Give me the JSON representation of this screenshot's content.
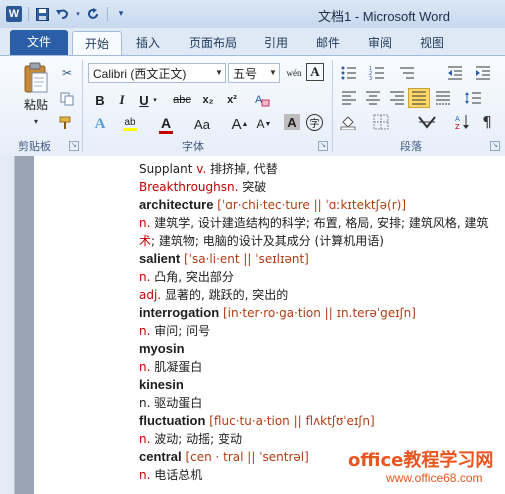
{
  "window": {
    "title": "文档1 - Microsoft Word"
  },
  "qat": {
    "app_icon": "W"
  },
  "tabs": [
    {
      "label": "文件"
    },
    {
      "label": "开始"
    },
    {
      "label": "插入"
    },
    {
      "label": "页面布局"
    },
    {
      "label": "引用"
    },
    {
      "label": "邮件"
    },
    {
      "label": "审阅"
    },
    {
      "label": "视图"
    }
  ],
  "ribbon": {
    "paste_label": "粘贴",
    "font_name": "Calibri (西文正文)",
    "font_size": "五号",
    "groups": {
      "clipboard": "剪贴板",
      "font": "字体",
      "paragraph": "段落"
    },
    "buttons": {
      "bold": "B",
      "italic": "I",
      "underline": "U",
      "strike": "abc",
      "subscript": "x₂",
      "superscript": "x²",
      "grow": "A",
      "shrink": "A",
      "change_case": "Aa",
      "font_color": "A",
      "highlight": "ab",
      "text_effect": "A",
      "wen": "wén"
    }
  },
  "document": {
    "lines": [
      {
        "parts": [
          {
            "t": "Supplant ",
            "c": "plain"
          },
          {
            "t": "v.",
            "c": "pos"
          },
          {
            "t": "  排挤掉, 代替",
            "c": "plain"
          }
        ]
      },
      {
        "parts": [
          {
            "t": "Breakthroughs",
            "c": "red"
          },
          {
            "t": "n.",
            "c": "pos"
          },
          {
            "t": "  突破",
            "c": "plain"
          }
        ]
      },
      {
        "parts": [
          {
            "t": "architecture",
            "c": "word"
          },
          {
            "t": "  [ˈɑr·chi·tec·ture || ˈɑːkɪtektʃə(r)]",
            "c": "ph"
          }
        ]
      },
      {
        "parts": [
          {
            "t": "n.",
            "c": "pos"
          },
          {
            "t": "  建筑学, 设计建造结构的科学; 布置, 格局, 安排; 建筑风格, 建筑",
            "c": "plain"
          }
        ]
      },
      {
        "parts": [
          {
            "t": "术",
            "c": "red"
          },
          {
            "t": "; 建筑物; 电脑的设计及其成分 (计算机用语)",
            "c": "plain"
          }
        ]
      },
      {
        "parts": [
          {
            "t": "salient",
            "c": "word"
          },
          {
            "t": "  [ˈsa·li·ent || ˈseɪlɪənt]",
            "c": "ph"
          }
        ]
      },
      {
        "parts": [
          {
            "t": "n.",
            "c": "pos"
          },
          {
            "t": "  凸角, 突出部分",
            "c": "plain"
          }
        ]
      },
      {
        "parts": [
          {
            "t": "adj.",
            "c": "pos"
          },
          {
            "t": "  显著的, 跳跃的, 突出的",
            "c": "plain"
          }
        ]
      },
      {
        "parts": [
          {
            "t": "interrogation",
            "c": "word"
          },
          {
            "t": "  [in·ter·ro·ga·tion || ɪn.terəˈgeɪʃn]",
            "c": "ph"
          }
        ]
      },
      {
        "parts": [
          {
            "t": "n.",
            "c": "pos"
          },
          {
            "t": "  审问; 问号",
            "c": "plain"
          }
        ]
      },
      {
        "parts": [
          {
            "t": "myosin",
            "c": "word"
          }
        ]
      },
      {
        "parts": [
          {
            "t": "n.",
            "c": "pos"
          },
          {
            "t": "  肌凝蛋白",
            "c": "plain"
          }
        ]
      },
      {
        "parts": [
          {
            "t": "kinesin",
            "c": "word"
          }
        ]
      },
      {
        "parts": [
          {
            "t": "n.",
            "c": "plain"
          },
          {
            "t": "  驱动蛋白",
            "c": "plain"
          }
        ]
      },
      {
        "parts": [
          {
            "t": "fluctuation",
            "c": "word"
          },
          {
            "t": "  [fluc·tu·a·tion || flʌktʃʊˈeɪʃn]",
            "c": "ph"
          }
        ]
      },
      {
        "parts": [
          {
            "t": "n.",
            "c": "pos"
          },
          {
            "t": "  波动; 动摇; 变动",
            "c": "plain"
          }
        ]
      },
      {
        "parts": [
          {
            "t": "central",
            "c": "word"
          },
          {
            "t": "  [cen · tral || ˈsentrəl]",
            "c": "ph"
          }
        ]
      },
      {
        "parts": [
          {
            "t": "n.",
            "c": "pos"
          },
          {
            "t": "  电话总机",
            "c": "plain"
          }
        ]
      }
    ]
  },
  "watermark": {
    "line1": "office教程学习网",
    "line2": "www.office68.com"
  },
  "colors": {
    "file_tab": "#2a5fa8",
    "accent_red": "#c00000",
    "watermark": "#e8551f"
  }
}
